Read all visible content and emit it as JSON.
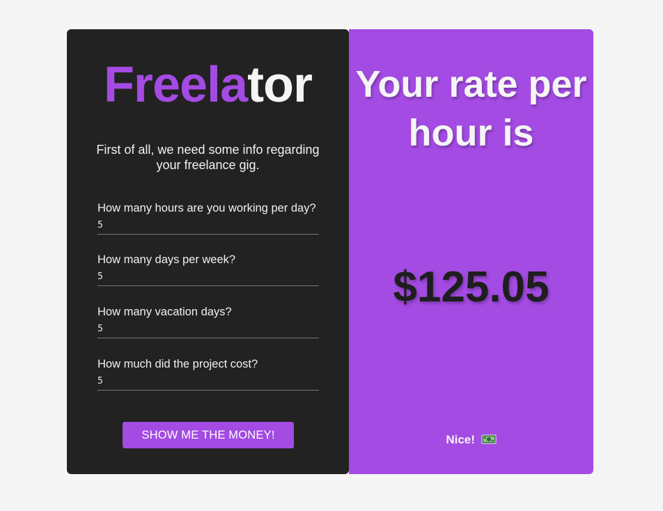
{
  "logo": {
    "part1": "Freela",
    "part2": "tor"
  },
  "intro": "First of all, we need some info regarding your freelance gig.",
  "fields": [
    {
      "label": "How many hours are you working per day?",
      "value": "5"
    },
    {
      "label": "How many days per week?",
      "value": "5"
    },
    {
      "label": "How many vacation days?",
      "value": "5"
    },
    {
      "label": "How much did the project cost?",
      "value": "5"
    }
  ],
  "submit_label": "SHOW ME THE MONEY!",
  "result": {
    "headline": "Your rate per hour is",
    "amount": "$125.05",
    "message": "Nice!",
    "message_icon": "money-bill-icon"
  },
  "colors": {
    "accent": "#a44be3",
    "panel": "#222222",
    "background": "#f5f5f5"
  }
}
